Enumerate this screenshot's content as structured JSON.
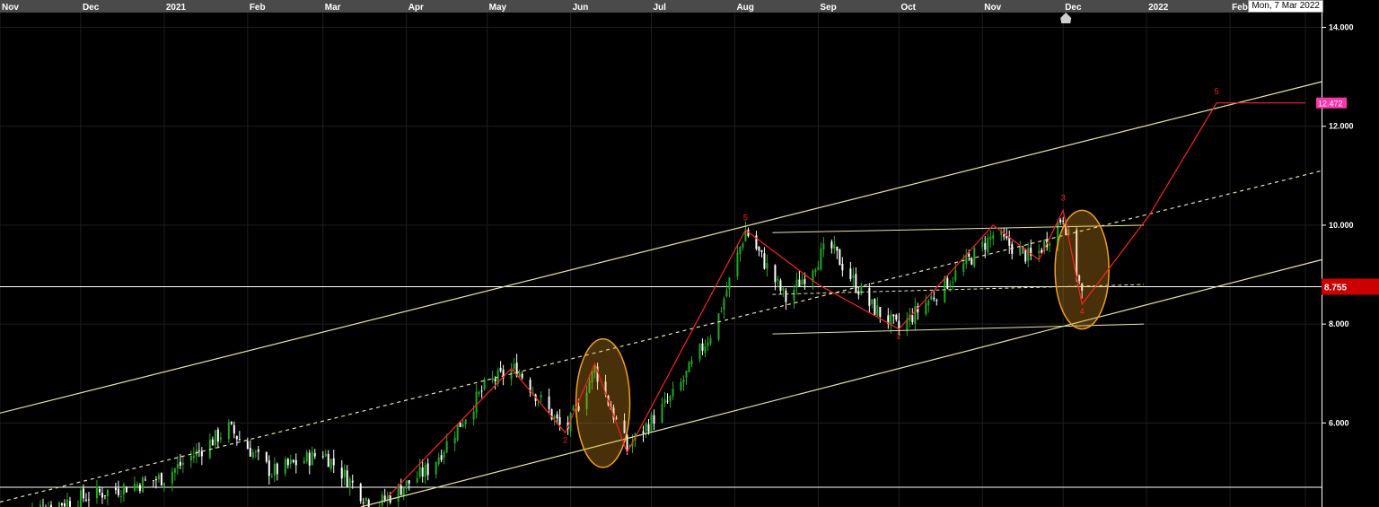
{
  "cursor_date": "Mon, 7 Mar 2022",
  "colors": {
    "background": "#000000",
    "grid": "#1e1e1e",
    "channel": "#e8e4a0",
    "wave": "#ff2020",
    "ellipse": "#f0a020",
    "up_candle": "#22aa22",
    "down_candle": "#ffffff",
    "last_price_badge": "#cc0000",
    "target_badge": "#ff33aa"
  },
  "chart_data": {
    "type": "candlestick",
    "x_tick_labels": [
      "Nov",
      "Dec",
      "2021",
      "Feb",
      "Mar",
      "Apr",
      "May",
      "Jun",
      "Jul",
      "Aug",
      "Sep",
      "Oct",
      "Nov",
      "Dec",
      "2022",
      "Feb"
    ],
    "y_tick_labels": [
      "14.000",
      "12.000",
      "10.000",
      "8.000",
      "6.000"
    ],
    "y_ticks": [
      14,
      12,
      10,
      8,
      6
    ],
    "ylim": [
      4.3,
      14.3
    ],
    "x_range": [
      "2020-11-01",
      "2022-03-07"
    ],
    "last_price": 8.755,
    "last_price_label": "8.755",
    "target_price": 12.472,
    "target_label": "12.472",
    "horizontal_lines": [
      8.755,
      4.7
    ],
    "trend_channel": {
      "upper": [
        [
          "2020-11-01",
          6.2
        ],
        [
          "2022-03-07",
          12.9
        ]
      ],
      "middle": [
        [
          "2020-11-01",
          4.4
        ],
        [
          "2022-03-07",
          11.1
        ]
      ],
      "lower": [
        [
          "2021-03-15",
          4.3
        ],
        [
          "2022-03-07",
          9.3
        ]
      ]
    },
    "range_lines": {
      "top": [
        [
          "2021-08-15",
          9.85
        ],
        [
          "2021-12-31",
          10.0
        ]
      ],
      "mid": [
        [
          "2021-08-15",
          8.6
        ],
        [
          "2021-12-31",
          8.8
        ]
      ],
      "bottom": [
        [
          "2021-08-15",
          7.8
        ],
        [
          "2021-12-31",
          8.0
        ]
      ]
    },
    "wave_path": [
      [
        "2021-03-25",
        4.5
      ],
      [
        "2021-05-10",
        7.1
      ],
      [
        "2021-05-30",
        5.8
      ],
      [
        "2021-06-10",
        7.2
      ],
      [
        "2021-06-22",
        5.4
      ],
      [
        "2021-08-05",
        9.9
      ],
      [
        "2021-09-01",
        8.8
      ],
      [
        "2021-10-01",
        7.9
      ],
      [
        "2021-11-05",
        10.0
      ],
      [
        "2021-11-22",
        9.3
      ],
      [
        "2021-12-01",
        10.3
      ],
      [
        "2021-12-08",
        8.4
      ],
      [
        "2022-01-02",
        10.2
      ],
      [
        "2022-01-27",
        12.472
      ],
      [
        "2022-03-01",
        12.472
      ]
    ],
    "wave_labels": [
      {
        "date": "2021-05-30",
        "price": 5.6,
        "text": "2"
      },
      {
        "date": "2021-08-05",
        "price": 10.1,
        "text": "5"
      },
      {
        "date": "2021-10-01",
        "price": 7.7,
        "text": "2"
      },
      {
        "date": "2021-12-01",
        "price": 10.5,
        "text": "3"
      },
      {
        "date": "2021-12-08",
        "price": 8.2,
        "text": "4"
      },
      {
        "date": "2022-01-27",
        "price": 12.65,
        "text": "5"
      }
    ],
    "ellipses": [
      {
        "center_date": "2021-06-13",
        "center_price": 6.4,
        "half_days": 10,
        "half_price": 1.3
      },
      {
        "center_date": "2021-12-08",
        "center_price": 9.1,
        "half_days": 10,
        "half_price": 1.2
      }
    ],
    "price_anchors": [
      [
        "2020-11-10",
        4.2
      ],
      [
        "2021-01-01",
        4.9
      ],
      [
        "2021-01-25",
        5.9
      ],
      [
        "2021-02-10",
        5.0
      ],
      [
        "2021-03-01",
        5.4
      ],
      [
        "2021-03-20",
        4.3
      ],
      [
        "2021-04-10",
        5.1
      ],
      [
        "2021-05-01",
        6.8
      ],
      [
        "2021-05-12",
        7.1
      ],
      [
        "2021-05-30",
        5.8
      ],
      [
        "2021-06-10",
        7.1
      ],
      [
        "2021-06-22",
        5.5
      ],
      [
        "2021-07-10",
        6.6
      ],
      [
        "2021-07-25",
        8.0
      ],
      [
        "2021-08-05",
        9.9
      ],
      [
        "2021-08-20",
        8.5
      ],
      [
        "2021-09-05",
        9.6
      ],
      [
        "2021-09-20",
        8.4
      ],
      [
        "2021-10-01",
        7.9
      ],
      [
        "2021-10-20",
        8.9
      ],
      [
        "2021-11-05",
        9.8
      ],
      [
        "2021-11-20",
        9.3
      ],
      [
        "2021-12-01",
        10.2
      ],
      [
        "2021-12-08",
        8.6
      ]
    ]
  }
}
